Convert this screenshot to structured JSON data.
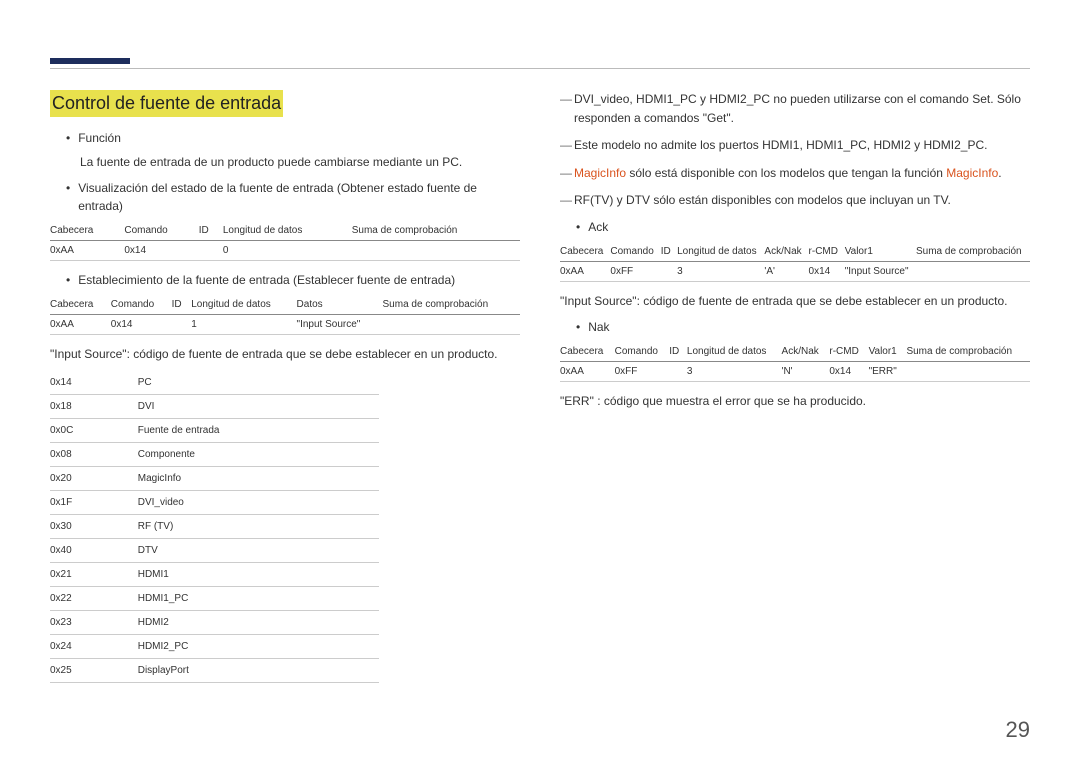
{
  "pageNumber": "29",
  "left": {
    "title": "Control de fuente de entrada",
    "funcLabel": "Función",
    "funcDesc": "La fuente de entrada de un producto puede cambiarse mediante un PC.",
    "visStatus": "Visualización del estado de la fuente de entrada (Obtener estado fuente de entrada)",
    "table1": {
      "headers": [
        "Cabecera",
        "Comando",
        "ID",
        "Longitud de datos",
        "Suma de comprobación"
      ],
      "row": [
        "0xAA",
        "0x14",
        "",
        "0",
        ""
      ]
    },
    "setSource": "Establecimiento de la fuente de entrada (Establecer fuente de entrada)",
    "table2": {
      "headers": [
        "Cabecera",
        "Comando",
        "ID",
        "Longitud de datos",
        "Datos",
        "Suma de comprobación"
      ],
      "row": [
        "0xAA",
        "0x14",
        "",
        "1",
        "\"Input Source\"",
        ""
      ]
    },
    "inputSourceNote": "\"Input Source\": código de fuente de entrada que se debe establecer en un producto.",
    "codes": [
      [
        "0x14",
        "PC"
      ],
      [
        "0x18",
        "DVI"
      ],
      [
        "0x0C",
        "Fuente de entrada"
      ],
      [
        "0x08",
        "Componente"
      ],
      [
        "0x20",
        "MagicInfo"
      ],
      [
        "0x1F",
        "DVI_video"
      ],
      [
        "0x30",
        "RF (TV)"
      ],
      [
        "0x40",
        "DTV"
      ],
      [
        "0x21",
        "HDMI1"
      ],
      [
        "0x22",
        "HDMI1_PC"
      ],
      [
        "0x23",
        "HDMI2"
      ],
      [
        "0x24",
        "HDMI2_PC"
      ],
      [
        "0x25",
        "DisplayPort"
      ]
    ]
  },
  "right": {
    "note1": "DVI_video, HDMI1_PC y HDMI2_PC no pueden utilizarse con el comando Set. Sólo responden a comandos \"Get\".",
    "note2": "Este modelo no admite los puertos HDMI1, HDMI1_PC, HDMI2 y HDMI2_PC.",
    "note3a": "MagicInfo",
    "note3b": " sólo está disponible con los modelos que tengan la función ",
    "note3c": "MagicInfo",
    "note3d": ".",
    "note4": "RF(TV) y DTV sólo están disponibles con modelos que incluyan un TV.",
    "ackLabel": "Ack",
    "ackTable": {
      "headers": [
        "Cabecera",
        "Comando",
        "ID",
        "Longitud de datos",
        "Ack/Nak",
        "r-CMD",
        "Valor1",
        "Suma de comprobación"
      ],
      "row": [
        "0xAA",
        "0xFF",
        "",
        "3",
        "'A'",
        "0x14",
        "\"Input Source\"",
        ""
      ]
    },
    "ackNote": "\"Input Source\": código de fuente de entrada que se debe establecer en un producto.",
    "nakLabel": "Nak",
    "nakTable": {
      "headers": [
        "Cabecera",
        "Comando",
        "ID",
        "Longitud de datos",
        "Ack/Nak",
        "r-CMD",
        "Valor1",
        "Suma de comprobación"
      ],
      "row": [
        "0xAA",
        "0xFF",
        "",
        "3",
        "'N'",
        "0x14",
        "\"ERR\"",
        ""
      ]
    },
    "errNote": "\"ERR\" : código que muestra el error que se ha producido."
  }
}
